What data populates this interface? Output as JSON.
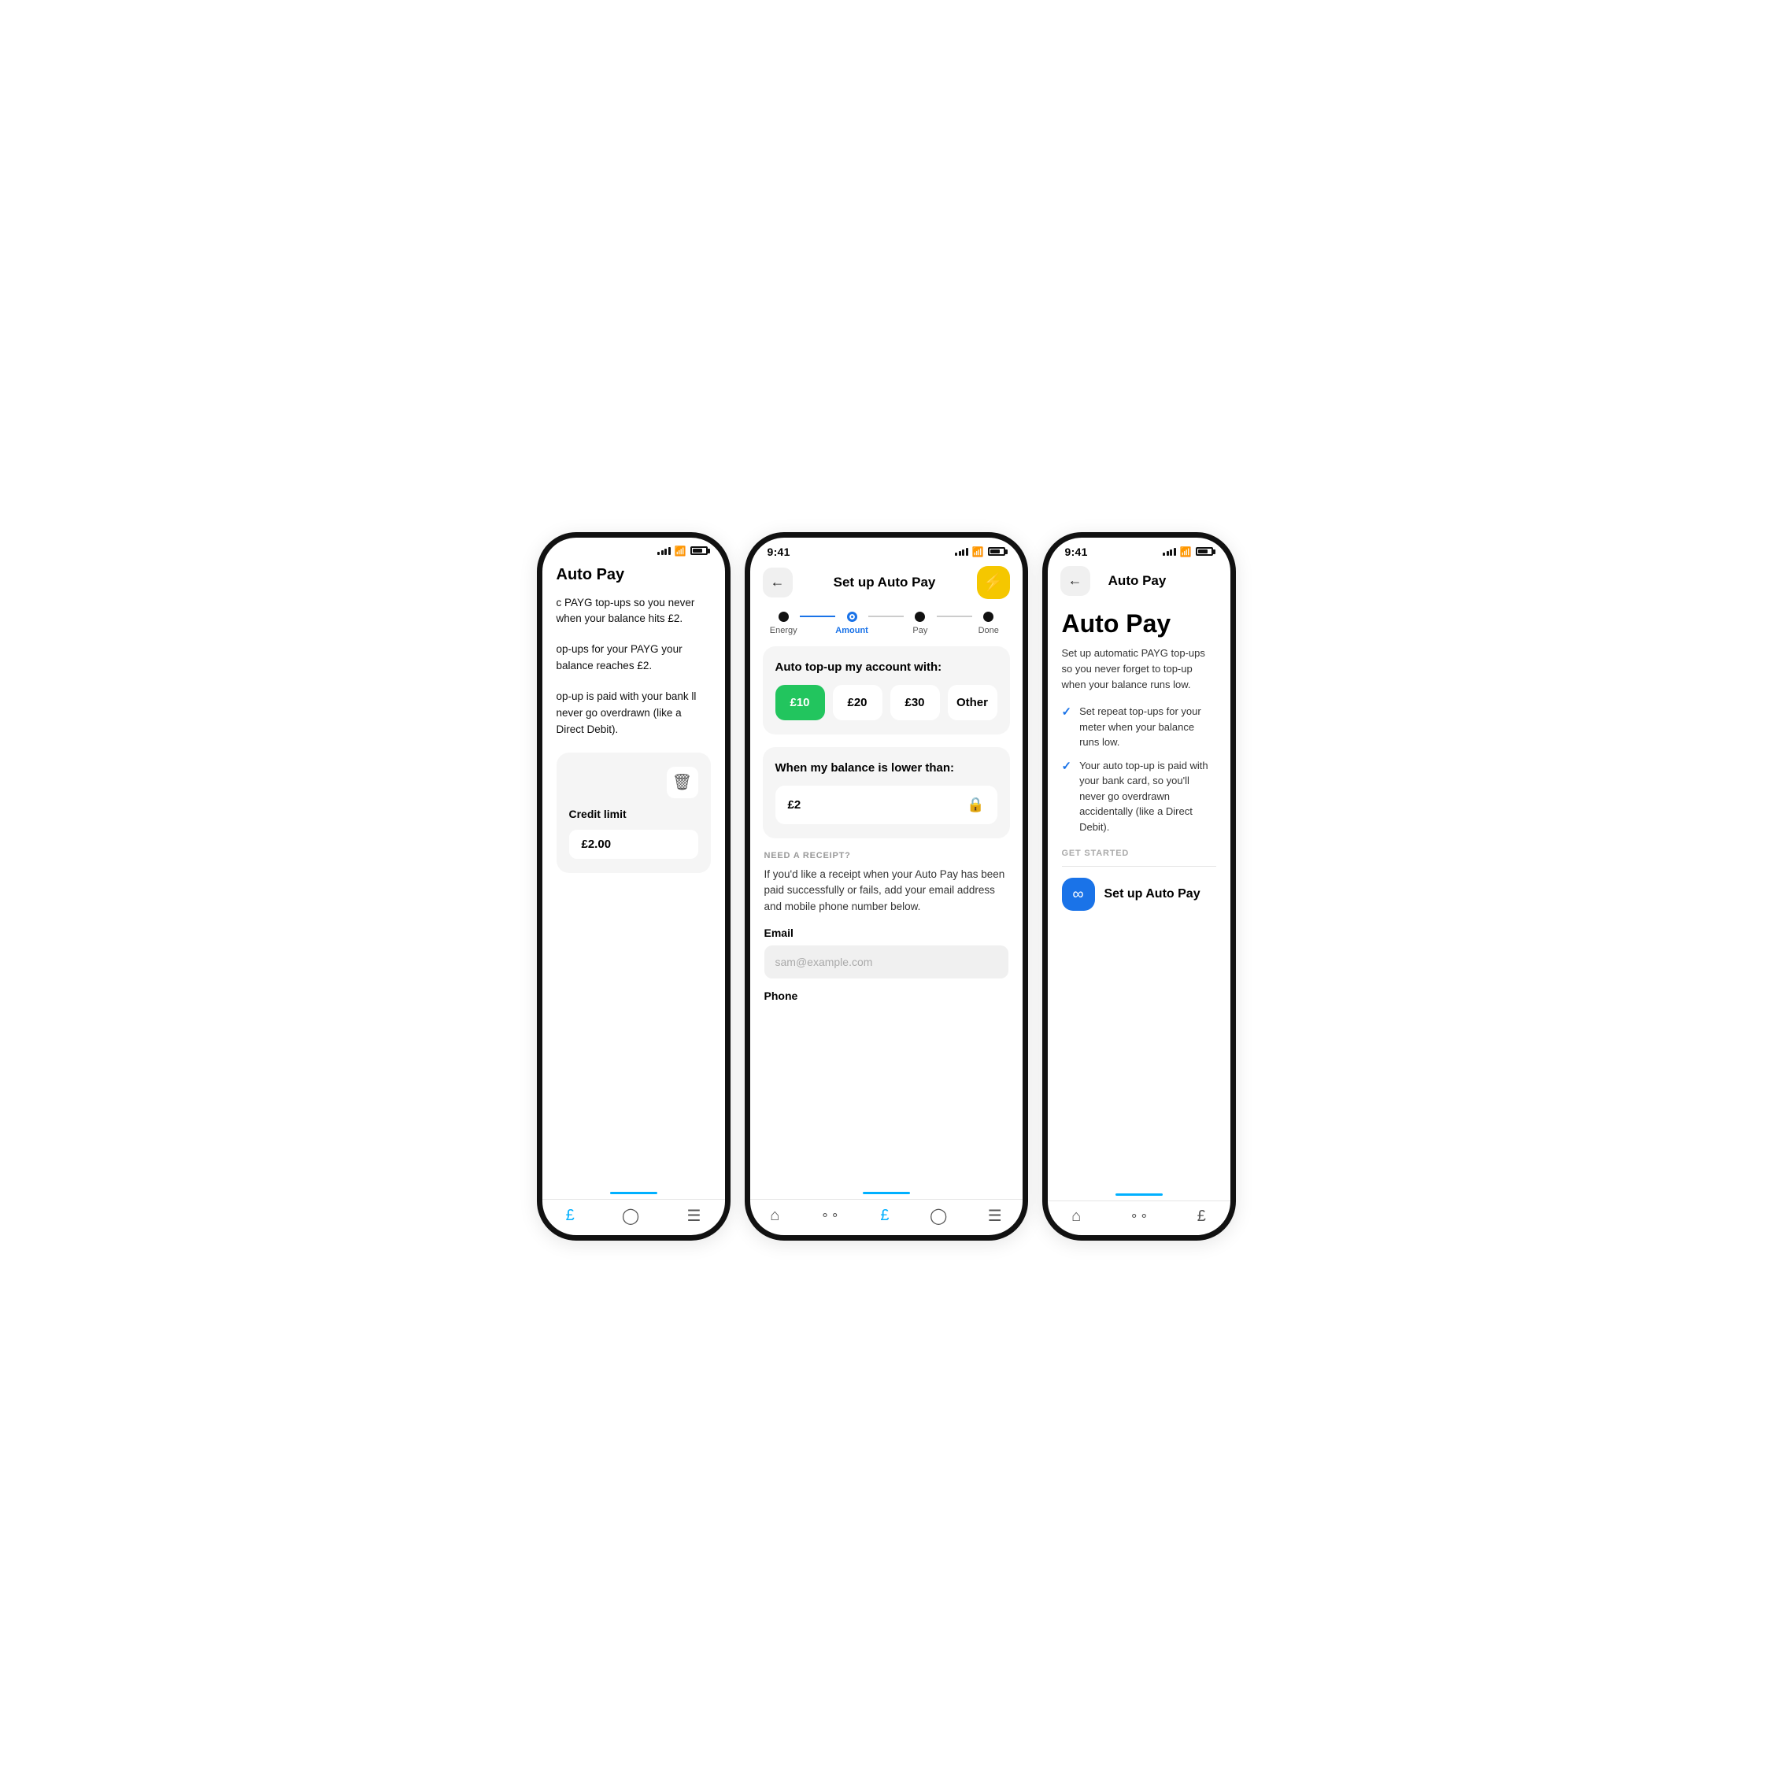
{
  "left_phone": {
    "title": "Auto Pay",
    "body_text1": "c PAYG top-ups so you never when your balance hits £2.",
    "body_text2": "op-ups for your PAYG your balance reaches £2.",
    "body_text3": "op-up is paid with your bank ll never go overdrawn (like a Direct Debit).",
    "credit_limit_label": "Credit limit",
    "credit_limit_value": "£2.00",
    "nav_icons": [
      "£",
      "?",
      "≡"
    ]
  },
  "center_phone": {
    "status_time": "9:41",
    "header_title": "Set up Auto Pay",
    "steps": [
      {
        "label": "Energy",
        "state": "done"
      },
      {
        "label": "Amount",
        "state": "active"
      },
      {
        "label": "Pay",
        "state": "inactive"
      },
      {
        "label": "Done",
        "state": "inactive"
      }
    ],
    "card1_title": "Auto top-up my account with:",
    "amount_options": [
      {
        "label": "£10",
        "selected": true
      },
      {
        "label": "£20",
        "selected": false
      },
      {
        "label": "£30",
        "selected": false
      },
      {
        "label": "Other",
        "selected": false
      }
    ],
    "card2_title": "When my balance is lower than:",
    "balance_value": "£2",
    "receipt_section_label": "NEED A RECEIPT?",
    "receipt_desc": "If you'd like a receipt when your Auto Pay has been paid successfully or fails, add your email address and mobile phone number below.",
    "email_label": "Email",
    "email_placeholder": "sam@example.com",
    "phone_label": "Phone",
    "nav_icons": [
      "🏠",
      "⟡",
      "£",
      "?",
      "≡"
    ]
  },
  "right_phone": {
    "status_time": "9:41",
    "header_title": "Auto Pay",
    "main_title": "Auto Pay",
    "desc": "Set up automatic PAYG top-ups so you never forget to top-up when your balance runs low.",
    "check_items": [
      "Set repeat top-ups for your meter when your balance runs low.",
      "Your auto top-up is paid with your bank card, so you'll never go overdrawn accidentally (like a Direct Debit)."
    ],
    "get_started_label": "GET STARTED",
    "setup_btn_label": "Set up Auto Pay",
    "nav_icons": [
      "🏠",
      "⟡",
      "£"
    ]
  },
  "icons": {
    "lightning": "⚡",
    "back_arrow": "←",
    "lock": "🔒",
    "trash": "🗑",
    "infinity": "∞",
    "check": "✓"
  }
}
